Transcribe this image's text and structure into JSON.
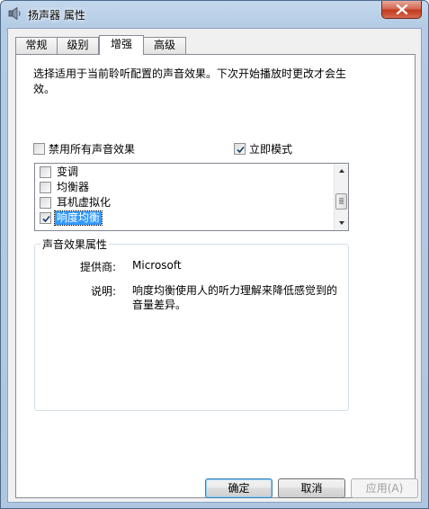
{
  "window": {
    "title": "扬声器 属性",
    "close_icon": "close-icon"
  },
  "tabs": [
    {
      "label": "常规",
      "active": false
    },
    {
      "label": "级别",
      "active": false
    },
    {
      "label": "增强",
      "active": true
    },
    {
      "label": "高级",
      "active": false
    }
  ],
  "enhancements": {
    "description": "选择适用于当前聆听配置的声音效果。下次开始播放时更改才会生效。",
    "disable_all": {
      "label": "禁用所有声音效果",
      "checked": false
    },
    "immediate_mode": {
      "label": "立即模式",
      "checked": true
    },
    "effects": [
      {
        "label": "变调",
        "checked": false,
        "selected": false
      },
      {
        "label": "均衡器",
        "checked": false,
        "selected": false
      },
      {
        "label": "耳机虚拟化",
        "checked": false,
        "selected": false
      },
      {
        "label": "响度均衡",
        "checked": true,
        "selected": true
      }
    ],
    "properties": {
      "title": "声音效果属性",
      "provider_label": "提供商:",
      "provider_value": "Microsoft",
      "desc_label": "说明:",
      "desc_value": "响度均衡使用人的听力理解来降低感觉到的音量差异。"
    }
  },
  "buttons": {
    "ok": "确定",
    "cancel": "取消",
    "apply": "应用(A)"
  }
}
